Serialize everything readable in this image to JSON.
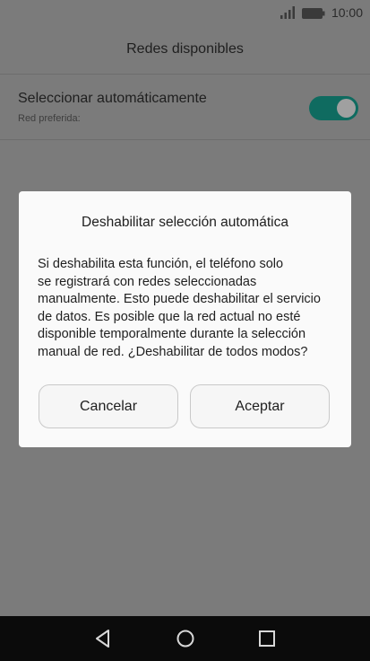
{
  "status_bar": {
    "time": "10:00",
    "icons": [
      "signal-icon",
      "battery-icon"
    ]
  },
  "header": {
    "title": "Redes disponibles"
  },
  "settings": {
    "auto_select": {
      "title": "Seleccionar automáticamente",
      "subtitle": "Red preferida:",
      "toggle_on": true
    }
  },
  "dialog": {
    "title": "Deshabilitar selección automática",
    "message_lines": [
      "Si deshabilita esta función, el teléfono solo",
      "se registrará con redes seleccionadas",
      "manualmente. Esto puede deshabilitar el servicio",
      "de datos. Es posible que la red actual no esté",
      "disponible temporalmente durante la selección",
      "manual de red. ¿Deshabilitar de todos modos?"
    ],
    "cancel_label": "Cancelar",
    "accept_label": "Aceptar"
  },
  "nav_bar": {
    "icons": [
      "back-icon",
      "home-icon",
      "recent-apps-icon"
    ]
  },
  "colors": {
    "toggle_accent": "#0f6b60",
    "dim_overlay": "#7b7b7b",
    "dialog_bg": "#fafafa",
    "nav_bg": "#0b0b0b"
  }
}
